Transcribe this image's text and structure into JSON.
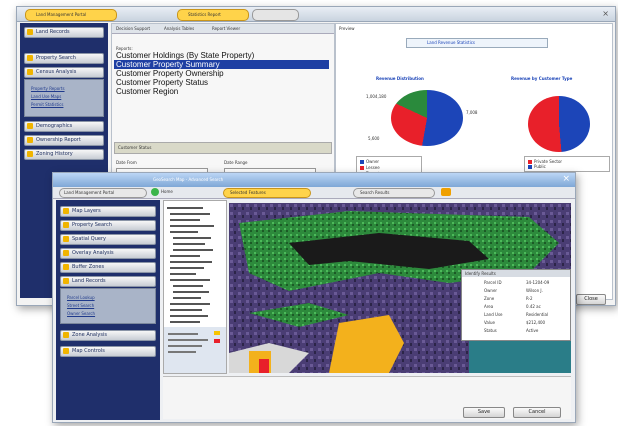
{
  "back_window": {
    "title_tab": "Land Management Portal",
    "tab2": "Statistics Report",
    "subtabs": [
      "Decision Support",
      "Analysis Tables",
      "Report Viewer"
    ],
    "sidebar_items": [
      "Land Records",
      "Property Search",
      "Census Analysis",
      "Demographics",
      "Ownership Report",
      "Zoning History",
      "Parcel Data"
    ],
    "sidebar_links": [
      "Property Reports",
      "Land Use Maps",
      "Permit Statistics"
    ],
    "reports_label": "Reports:",
    "list_items": [
      "Customer Holdings (By State Property)",
      "Customer Property Summary",
      "Customer Property Ownership",
      "Customer Property Status",
      "Customer Region"
    ],
    "filter_label": "Customer Status",
    "date_from_label": "Date From",
    "date_to_label": "Date Range",
    "group_label": "Group by Status",
    "preview_label": "Preview",
    "chart_header": "Land Revenue Statistics",
    "chart1_title": "Revenue Distribution",
    "chart2_title": "Revenue by Customer Type",
    "chart1_label_a": "1,004,180",
    "chart1_label_b": "7,008",
    "chart1_label_c": "5,600",
    "legend1": [
      "Owner",
      "Lessee",
      "Tenant"
    ],
    "legend2": [
      "Private Sector",
      "Public"
    ],
    "lower_caption": "Revenue Summary Report",
    "right_btn": "Close",
    "colors": {
      "sidebar": "#1f2f6b",
      "accent": "#f0b400",
      "pie_blue": "#1c45b8",
      "pie_red": "#e8202a",
      "pie_green": "#2a8a3c"
    }
  },
  "front_window": {
    "title_tab": "GeoSearch Map - Advanced Search",
    "toolbar_items": [
      "Land Management Portal",
      "Home",
      "Selected Features",
      "Search Results"
    ],
    "sidebar_items": [
      "Map Layers",
      "Property Search",
      "Spatial Query",
      "Overlay Analysis",
      "Buffer Zones",
      "Land Records",
      "Zone Analysis",
      "Map Controls"
    ],
    "sidebar_links": [
      "Parcel Lookup",
      "Street Search",
      "Owner Search"
    ],
    "popup_title": "Identify Results",
    "popup_rows": [
      [
        "Parcel ID",
        "34-1204-09"
      ],
      [
        "Owner",
        "Wilson J."
      ],
      [
        "Zone",
        "R-2"
      ],
      [
        "Area",
        "0.42 ac"
      ],
      [
        "Land Use",
        "Residential"
      ],
      [
        "Value",
        "$212,400"
      ],
      [
        "Status",
        "Active"
      ]
    ],
    "buttons": [
      "Save",
      "Cancel"
    ]
  }
}
